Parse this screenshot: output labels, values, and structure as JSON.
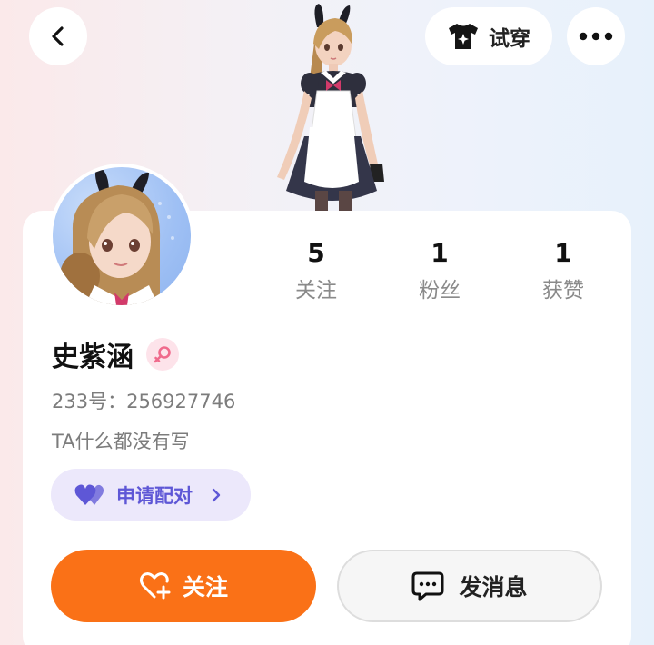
{
  "header": {
    "back_icon": "chevron-left-icon",
    "tryon_icon": "shirt-sparkle-icon",
    "tryon_label": "试穿",
    "more_icon": "more-dots-icon"
  },
  "profile": {
    "name": "史紫涵",
    "gender_icon": "female-icon",
    "uid": "233号：256927746",
    "bio": "TA什么都没有写"
  },
  "stats": [
    {
      "value": "5",
      "label": "关注"
    },
    {
      "value": "1",
      "label": "粉丝"
    },
    {
      "value": "1",
      "label": "获赞"
    }
  ],
  "pair": {
    "icon": "hearts-icon",
    "label": "申请配对",
    "accent": "#5e57d6",
    "background": "#ece8fb"
  },
  "actions": {
    "follow_label": "关注",
    "follow_color": "#fa7117",
    "message_label": "发消息"
  }
}
